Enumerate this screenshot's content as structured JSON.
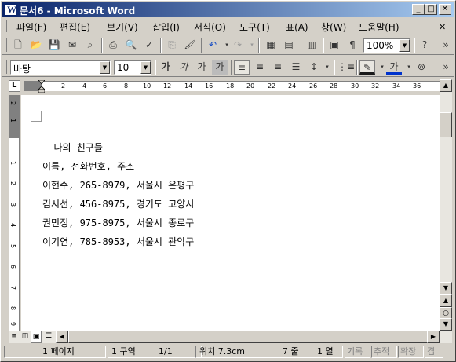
{
  "window": {
    "title": "문서6 - Microsoft Word",
    "minimize": "_",
    "maximize": "□",
    "close": "✕"
  },
  "menu": {
    "items": [
      "파일(F)",
      "편집(E)",
      "보기(V)",
      "삽입(I)",
      "서식(O)",
      "도구(T)",
      "표(A)",
      "창(W)",
      "도움말(H)"
    ]
  },
  "toolbar": {
    "zoom": "100%",
    "style": "바탕",
    "font_size": "10",
    "bold": "가",
    "italic": "가",
    "underline": "가",
    "shading": "가",
    "font_color": "가"
  },
  "ruler": {
    "numbers": [
      "2",
      "4",
      "6",
      "8",
      "10",
      "12",
      "14",
      "16",
      "18",
      "20",
      "22",
      "24",
      "26",
      "28",
      "30",
      "32",
      "34",
      "36"
    ],
    "vertical_numbers": [
      "2",
      "1",
      "1",
      "2",
      "3",
      "4",
      "5",
      "6",
      "7",
      "8",
      "9",
      "10"
    ]
  },
  "document": {
    "lines": [
      "- 나의 친구들",
      "이름, 전화번호, 주소",
      "이현수, 265-8979, 서울시 은평구",
      "김시선, 456-8975, 경기도 고양시",
      "권민정, 975-8975, 서울시 종로구",
      "이기연, 785-8953, 서울시 관악구"
    ]
  },
  "status": {
    "page": "1 페이지",
    "section": "1 구역",
    "pages": "1/1",
    "position": "위치 7.3cm",
    "line": "7 줄",
    "column": "1 열",
    "rec": "기록",
    "trk": "추적",
    "ext": "확장",
    "ovr": "겹"
  }
}
